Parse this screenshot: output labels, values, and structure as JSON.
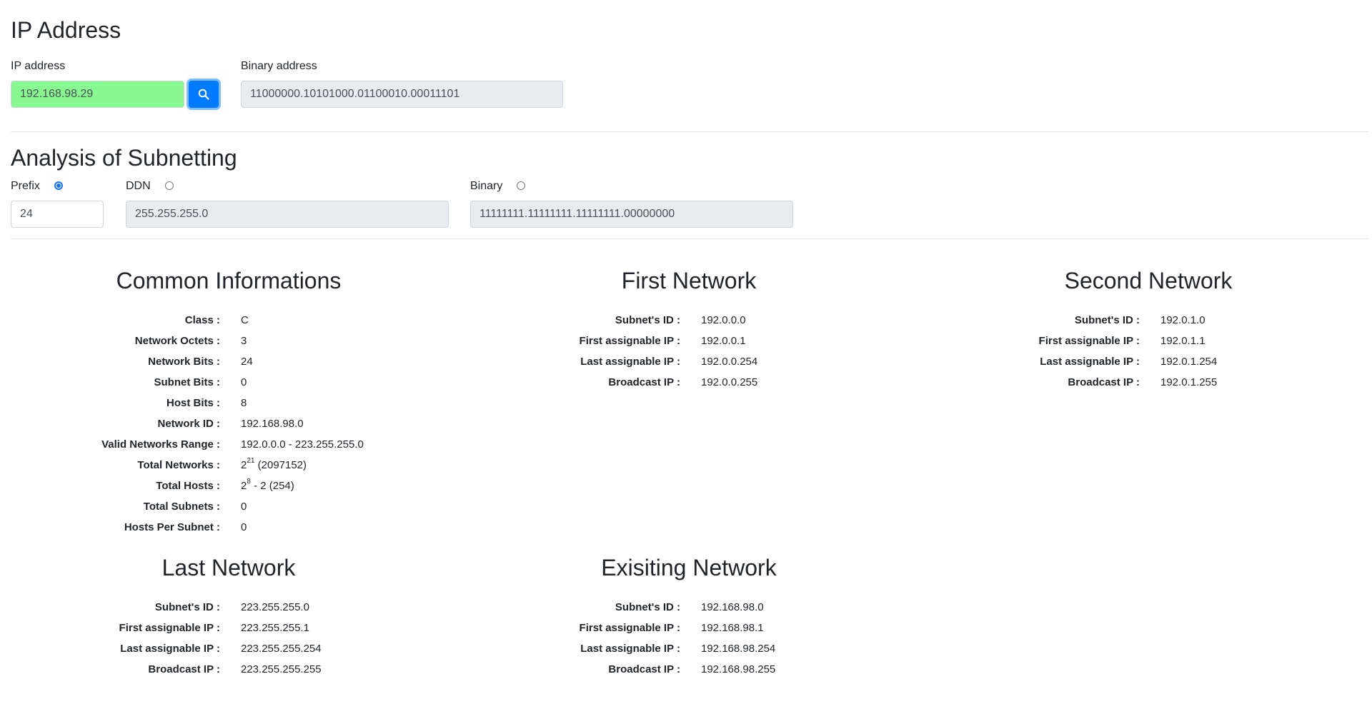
{
  "ip_section": {
    "title": "IP Address",
    "ip_label": "IP address",
    "ip_value": "192.168.98.29",
    "binary_label": "Binary address",
    "binary_value": "11000000.10101000.01100010.00011101",
    "valid_color": "#88f991",
    "search_icon": "search-icon"
  },
  "subnet_section": {
    "title": "Analysis of Subnetting",
    "prefix_label": "Prefix",
    "prefix_value": "24",
    "ddn_label": "DDN",
    "ddn_value": "255.255.255.0",
    "binary_label": "Binary",
    "binary_value": "11111111.11111111.11111111.00000000",
    "selected": "Prefix"
  },
  "common": {
    "title": "Common Informations",
    "rows": [
      {
        "k": "Class :",
        "v": "C"
      },
      {
        "k": "Network Octets :",
        "v": "3"
      },
      {
        "k": "Network Bits :",
        "v": "24"
      },
      {
        "k": "Subnet Bits :",
        "v": "0"
      },
      {
        "k": "Host Bits :",
        "v": "8"
      },
      {
        "k": "Network ID :",
        "v": "192.168.98.0"
      },
      {
        "k": "Valid Networks Range :",
        "v": "192.0.0.0 - 223.255.255.0"
      },
      {
        "k": "Total Networks :",
        "base": "2",
        "exp": "21",
        "rest": " (2097152)"
      },
      {
        "k": "Total Hosts :",
        "base": "2",
        "exp": "8",
        "rest": " - 2 (254)"
      },
      {
        "k": "Total Subnets :",
        "v": "0"
      },
      {
        "k": "Hosts Per Subnet :",
        "v": "0"
      }
    ]
  },
  "first": {
    "title": "First Network",
    "rows": [
      {
        "k": "Subnet's ID :",
        "v": "192.0.0.0"
      },
      {
        "k": "First assignable IP :",
        "v": "192.0.0.1"
      },
      {
        "k": "Last assignable IP :",
        "v": "192.0.0.254"
      },
      {
        "k": "Broadcast IP :",
        "v": "192.0.0.255"
      }
    ]
  },
  "second": {
    "title": "Second Network",
    "rows": [
      {
        "k": "Subnet's ID :",
        "v": "192.0.1.0"
      },
      {
        "k": "First assignable IP :",
        "v": "192.0.1.1"
      },
      {
        "k": "Last assignable IP :",
        "v": "192.0.1.254"
      },
      {
        "k": "Broadcast IP :",
        "v": "192.0.1.255"
      }
    ]
  },
  "last": {
    "title": "Last Network",
    "rows": [
      {
        "k": "Subnet's ID :",
        "v": "223.255.255.0"
      },
      {
        "k": "First assignable IP :",
        "v": "223.255.255.1"
      },
      {
        "k": "Last assignable IP :",
        "v": "223.255.255.254"
      },
      {
        "k": "Broadcast IP :",
        "v": "223.255.255.255"
      }
    ]
  },
  "existing": {
    "title": "Exisiting Network",
    "rows": [
      {
        "k": "Subnet's ID :",
        "v": "192.168.98.0"
      },
      {
        "k": "First assignable IP :",
        "v": "192.168.98.1"
      },
      {
        "k": "Last assignable IP :",
        "v": "192.168.98.254"
      },
      {
        "k": "Broadcast IP :",
        "v": "192.168.98.255"
      }
    ]
  }
}
